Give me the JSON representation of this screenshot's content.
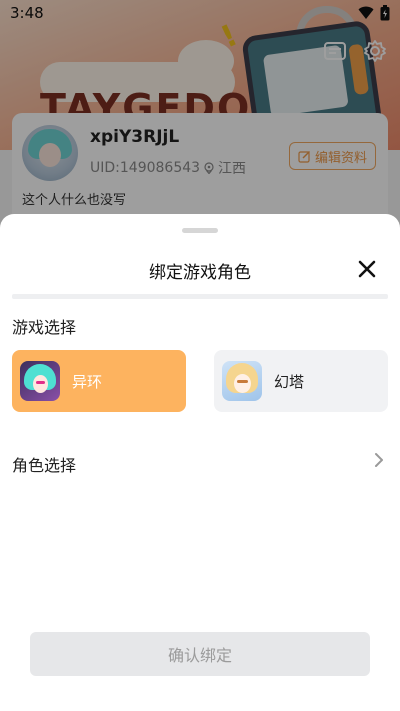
{
  "status_bar": {
    "time": "3:48"
  },
  "banner": {
    "brand_text": "TAYGEDO"
  },
  "profile": {
    "username": "xpiY3RJjL",
    "uid": "UID:149086543",
    "location": "江西",
    "edit_label": "编辑资料",
    "bio": "这个人什么也没写"
  },
  "sheet": {
    "title": "绑定游戏角色",
    "game_section_label": "游戏选择",
    "games": [
      {
        "name": "异环",
        "selected": true
      },
      {
        "name": "幻塔",
        "selected": false
      }
    ],
    "role_section_label": "角色选择",
    "confirm_label": "确认绑定"
  },
  "colors": {
    "accent": "#fdb35f",
    "edit_border": "#f0a862",
    "confirm_disabled_bg": "#e6e7e9",
    "option_unselected_bg": "#f1f2f4"
  },
  "icons": [
    "wifi-icon",
    "battery-icon",
    "card-icon",
    "gear-icon",
    "location-pin-icon",
    "edit-icon",
    "close-icon",
    "chevron-right-icon"
  ]
}
